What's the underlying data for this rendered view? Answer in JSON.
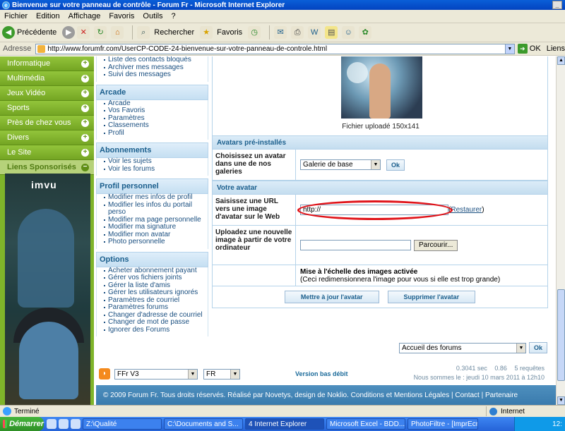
{
  "window": {
    "title": "Bienvenue sur votre panneau de contrôle - Forum Fr - Microsoft Internet Explorer"
  },
  "menubar": [
    "Fichier",
    "Edition",
    "Affichage",
    "Favoris",
    "Outils",
    "?"
  ],
  "toolbar": {
    "back_label": "Précédente",
    "search_label": "Rechercher",
    "favorites_label": "Favoris"
  },
  "addressbar": {
    "label": "Adresse",
    "url": "http://www.forumfr.com/UserCP-CODE-24-bienvenue-sur-votre-panneau-de-controle.html",
    "go_label": "OK",
    "links_label": "Liens"
  },
  "leftnav": {
    "items": [
      "Informatique",
      "Multimédia",
      "Jeux Vidéo",
      "Sports",
      "Près de chez vous",
      "Divers",
      "Le Site",
      "Liens Sponsorisés"
    ],
    "ad_brand": "imvu"
  },
  "midcol": {
    "top_links": [
      "Liste des contacts bloqués",
      "Archiver mes messages",
      "Suivi des messages"
    ],
    "sections": [
      {
        "title": "Arcade",
        "links": [
          "Arcade",
          "Vos Favoris",
          "Paramètres",
          "Classements",
          "Profil"
        ]
      },
      {
        "title": "Abonnements",
        "links": [
          "Voir les sujets",
          "Voir les forums"
        ]
      },
      {
        "title": "Profil personnel",
        "links": [
          "Modifier mes infos de profil",
          "Modifier les infos du portail perso",
          "Modifier ma page personnelle",
          "Modifier ma signature",
          "Modifier mon avatar",
          "Photo personnelle"
        ]
      },
      {
        "title": "Options",
        "links": [
          "Acheter abonnement payant",
          "Gérer vos fichiers joints",
          "Gérer la liste d'amis",
          "Gérer les utilisateurs ignorés",
          "Paramètres de courriel",
          "Paramètres forums",
          "Changer d'adresse de courriel",
          "Changer de mot de passe",
          "Ignorer des Forums"
        ]
      }
    ]
  },
  "content": {
    "avatar_caption": "Fichier uploadé 150x141",
    "preinstalled_head": "Avatars pré-installés",
    "choose_label": "Choisissez un avatar dans une de nos galeries",
    "gallery_value": "Galerie de base",
    "ok_label": "Ok",
    "your_avatar_head": "Votre avatar",
    "url_label": "Saisissez une URL vers une image d'avatar sur le Web",
    "url_value": "http://",
    "restore_label": "Restaurer",
    "upload_label": "Uploadez une nouvelle image à partir de votre ordinateur",
    "browse_label": "Parcourir...",
    "resize_title": "Mise à l'échelle des images activée",
    "resize_note": "(Ceci redimensionnera l'image pour vous si elle est trop grande)",
    "update_btn": "Mettre à jour l'avatar",
    "delete_btn": "Supprimer l'avatar"
  },
  "footer": {
    "jump_value": "Accueil des forums",
    "jump_ok": "Ok",
    "skin_value": "FFr V3",
    "lang_value": "FR",
    "low_link": "Version bas débit",
    "stat_time": "0.3041 sec",
    "stat_load": "0.86",
    "stat_queries": "5 requêtes",
    "date_line": "Nous sommes le : jeudi 10 mars 2011 à 12h10",
    "copyright": "© 2009 Forum Fr. Tous droits réservés. Réalisé par Novetys, design de Noklio. Conditions et Mentions Légales | Contact | Partenaire"
  },
  "statusbar": {
    "status": "Terminé",
    "zone": "Internet"
  },
  "taskbar": {
    "start_label": "Démarrer",
    "tasks": [
      "Z:\\Qualité",
      "C:\\Documents and S...",
      "4 Internet Explorer",
      "Microsoft Excel - BDD...",
      "PhotoFiltre - [ImprEcr..."
    ],
    "clock": "12:"
  }
}
